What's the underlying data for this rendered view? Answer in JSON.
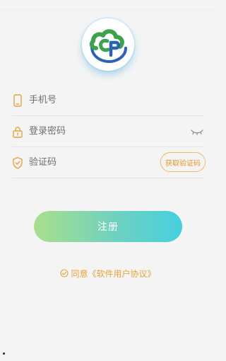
{
  "colors": {
    "background": "#f4f4f4",
    "accent_orange": "#eaa23a",
    "gradient_start": "#a9df8d",
    "gradient_end": "#47cfe0",
    "logo_green": "#3aa34b",
    "logo_blue": "#2b62b6"
  },
  "logo": {
    "icon": "cloud-cp-logo-icon"
  },
  "form": {
    "phone": {
      "icon": "phone-icon",
      "placeholder": "手机号",
      "value": ""
    },
    "password": {
      "icon": "lock-icon",
      "placeholder": "登录密码",
      "value": "",
      "toggle_icon": "eye-closed-icon"
    },
    "code": {
      "icon": "shield-check-icon",
      "placeholder": "验证码",
      "value": "",
      "send_code_label": "获取验证码"
    }
  },
  "register_button": {
    "label": "注册"
  },
  "agreement": {
    "icon": "check-circle-icon",
    "prefix": "同意",
    "link": "《软件用户协议》"
  }
}
